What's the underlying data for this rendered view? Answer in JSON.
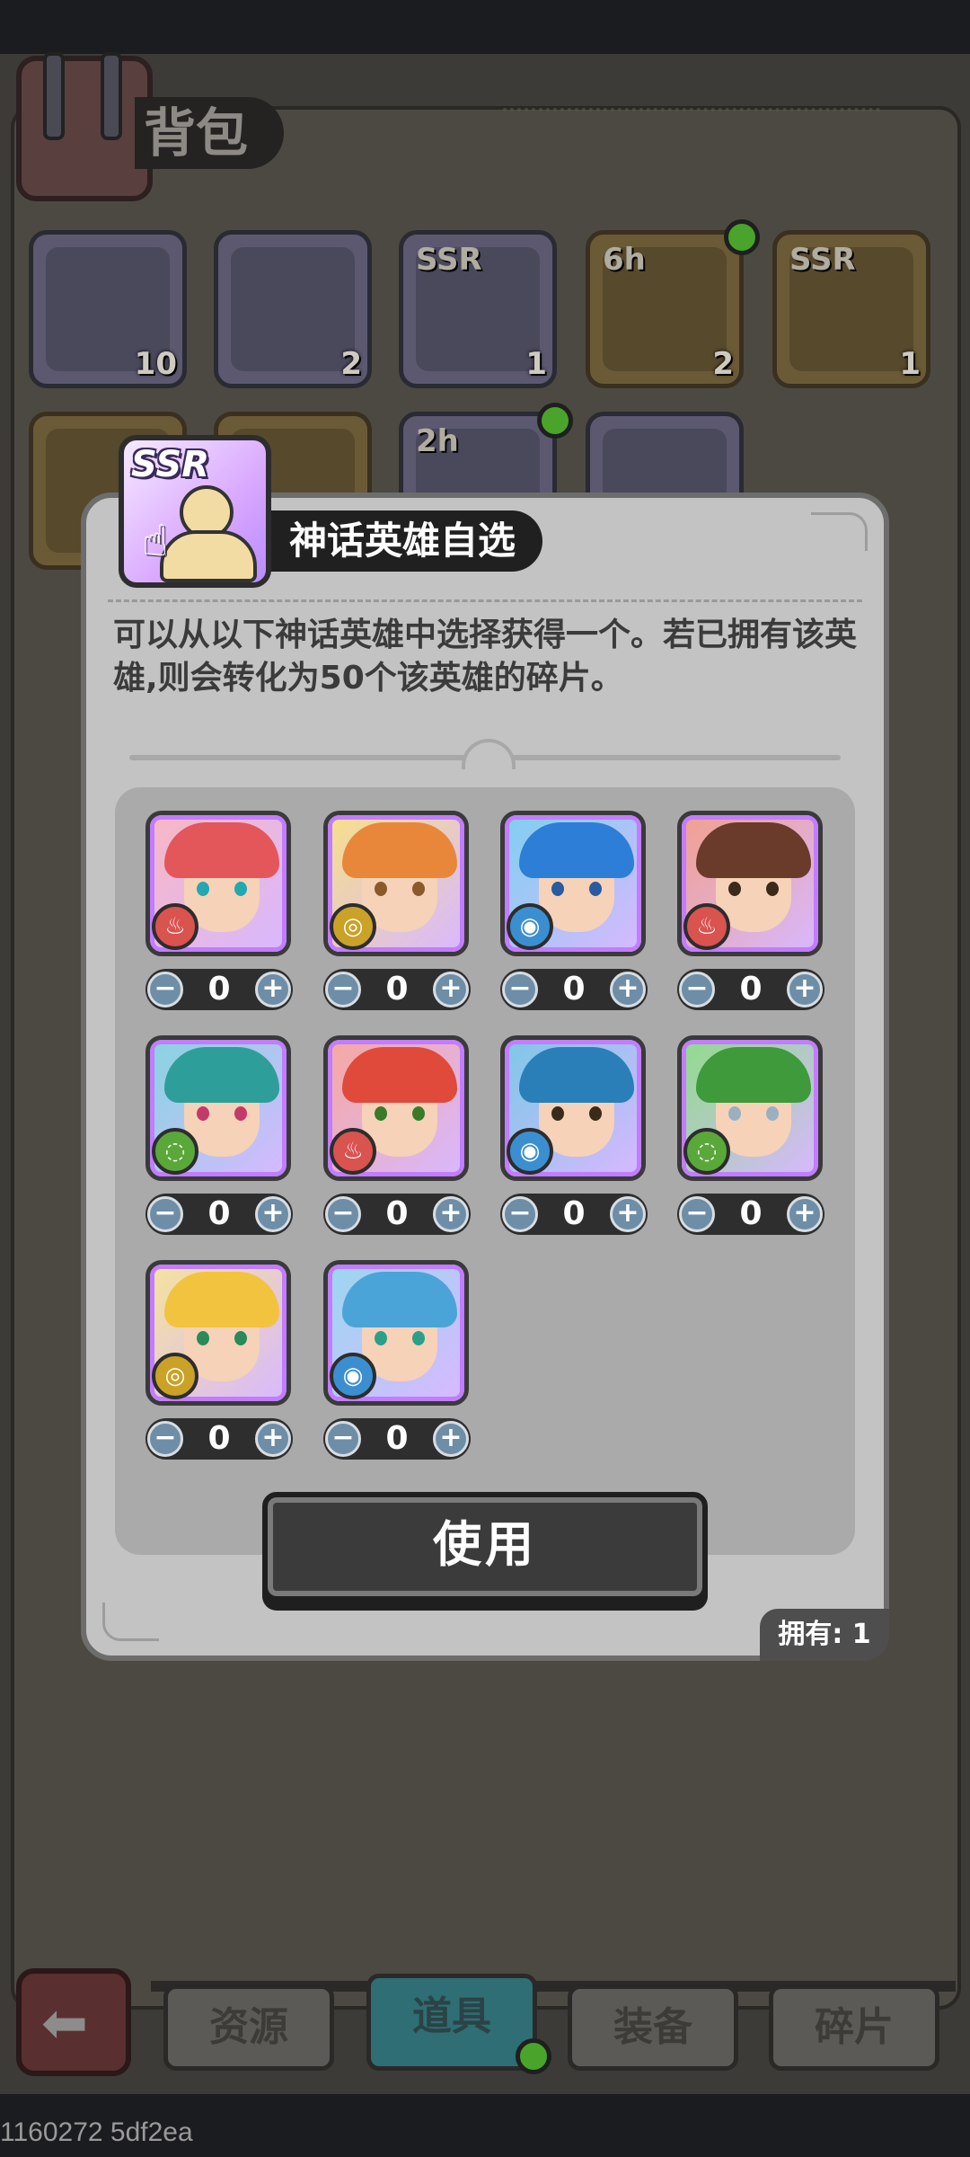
{
  "bag": {
    "title": "背包",
    "slots": [
      {
        "count": "10",
        "label": ""
      },
      {
        "count": "2",
        "label": ""
      },
      {
        "count": "1",
        "label": "SSR"
      },
      {
        "count": "2",
        "label": "6h"
      },
      {
        "count": "1",
        "label": "SSR"
      }
    ],
    "row2_labels": [
      "",
      "",
      "2h",
      ""
    ]
  },
  "dialog": {
    "item_badge": "SSR",
    "title": "神话英雄自选",
    "description": "可以从以下神话英雄中选择获得一个。若已拥有该英雄,则会转化为50个该英雄的碎片。",
    "heroes": [
      {
        "element": "fire",
        "value": "0"
      },
      {
        "element": "earth",
        "value": "0"
      },
      {
        "element": "water",
        "value": "0"
      },
      {
        "element": "fire",
        "value": "0"
      },
      {
        "element": "wind",
        "value": "0"
      },
      {
        "element": "fire",
        "value": "0"
      },
      {
        "element": "water",
        "value": "0"
      },
      {
        "element": "wind",
        "value": "0"
      },
      {
        "element": "earth",
        "value": "0"
      },
      {
        "element": "water",
        "value": "0"
      }
    ],
    "use_label": "使用",
    "owned_label": "拥有: 1"
  },
  "tabs": [
    "资源",
    "道具",
    "装备",
    "碎片"
  ],
  "active_tab": "道具",
  "build_id": "1160272 5df2ea",
  "colors": {
    "fire": "#d9534f",
    "earth": "#c9a227",
    "water": "#3b8fd0",
    "wind": "#5aa83a",
    "accent_purple": "#c27cff"
  }
}
